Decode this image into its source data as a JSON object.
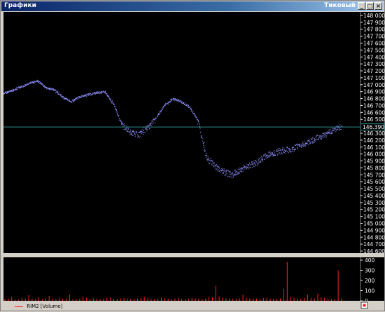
{
  "window": {
    "title": "Графики",
    "subtitle": "Тиковый"
  },
  "colors": {
    "price_line": "#8f8fff",
    "volume_bars": "#ff2020",
    "current_price_line": "#2e8b8b",
    "background": "#000000",
    "axis_text": "#ffffff"
  },
  "legend": {
    "label": "RIM2 [Volume]"
  },
  "current_price_label": "146.390",
  "chart_data": [
    {
      "type": "line",
      "name": "price",
      "yaxis_ticks": [
        "148 000",
        "147 900",
        "147 800",
        "147 700",
        "147 600",
        "147 500",
        "147 400",
        "147 300",
        "147 200",
        "147 100",
        "147 000",
        "146 900",
        "146 800",
        "146 700",
        "146 600",
        "146 500",
        "146 400",
        "146 300",
        "146 200",
        "146 100",
        "146 000",
        "145 900",
        "145 800",
        "145 700",
        "145 600",
        "145 500",
        "145 400",
        "145 300",
        "145 200",
        "145 100",
        "145 000",
        "144 900",
        "144 800",
        "144 700",
        "144 600"
      ],
      "ylim": [
        144570,
        148050
      ],
      "current_price": 146390,
      "x": [
        0,
        2,
        4,
        6,
        8,
        10,
        12,
        14,
        16,
        18,
        20,
        22,
        24,
        26,
        28,
        30,
        32,
        34,
        36,
        38,
        40,
        42,
        44,
        46,
        48,
        50,
        52,
        54,
        56,
        58,
        60,
        62,
        64,
        66,
        68,
        70,
        72,
        74,
        76,
        78,
        80
      ],
      "values": [
        146880,
        146920,
        146970,
        147020,
        147060,
        146960,
        146930,
        146820,
        146760,
        146830,
        146860,
        146890,
        146900,
        146720,
        146420,
        146320,
        146280,
        146380,
        146520,
        146700,
        146800,
        146760,
        146680,
        146480,
        145950,
        145820,
        145750,
        145700,
        145780,
        145840,
        145880,
        145980,
        146020,
        146050,
        146070,
        146120,
        146180,
        146230,
        146280,
        146350,
        146390
      ]
    },
    {
      "type": "bar",
      "name": "volume",
      "yaxis_ticks": [
        "400",
        "300",
        "200",
        "100",
        "0"
      ],
      "ylim": [
        0,
        400
      ],
      "values": [
        18,
        22,
        40,
        15,
        12,
        30,
        25,
        55,
        20,
        18,
        35,
        12,
        28,
        48,
        22,
        15,
        32,
        20,
        25,
        60,
        18,
        14,
        22,
        40,
        30,
        18,
        25,
        20,
        15,
        22,
        28,
        35,
        20,
        18,
        26,
        30,
        24,
        20,
        18,
        22,
        32,
        40,
        26,
        20,
        18,
        25,
        30,
        22,
        20,
        18,
        24,
        28,
        20,
        16,
        22,
        30,
        26,
        20,
        18,
        22,
        40,
        35,
        150,
        42,
        30,
        25,
        22,
        20,
        18,
        26,
        60,
        30,
        25,
        22,
        20,
        18,
        28,
        30,
        20,
        18,
        22,
        25,
        120,
        380,
        40,
        30,
        25,
        22,
        28,
        60,
        30,
        25,
        70,
        35,
        28,
        22,
        20,
        18,
        300,
        25
      ]
    }
  ]
}
